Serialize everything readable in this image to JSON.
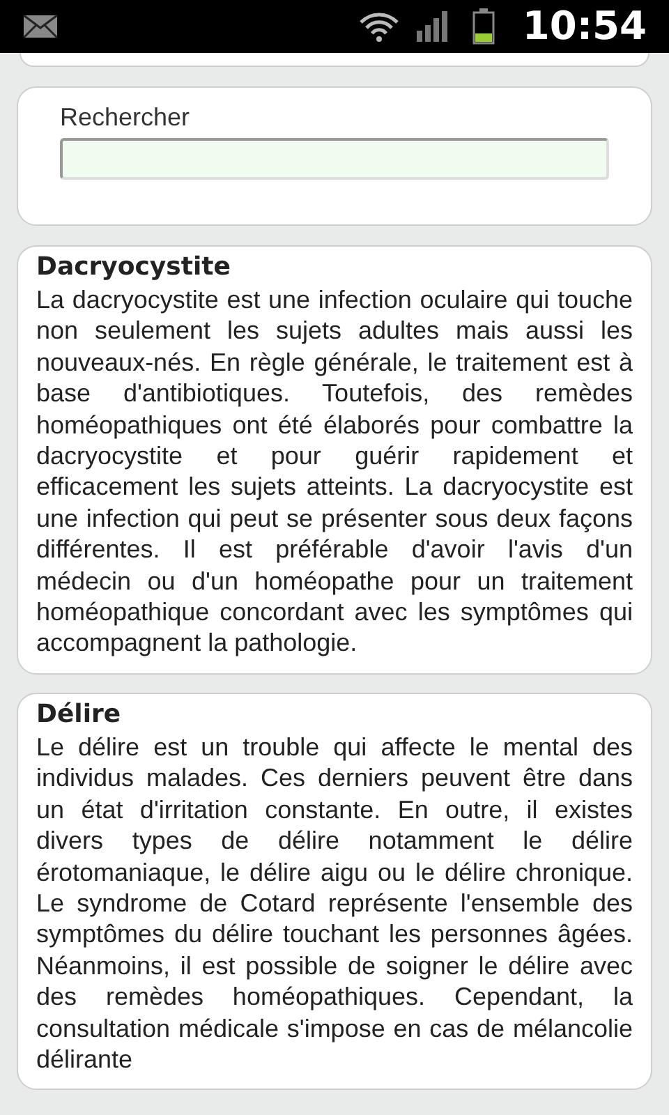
{
  "status_bar": {
    "time": "10:54"
  },
  "search": {
    "label": "Rechercher"
  },
  "articles": [
    {
      "title": "Dacryocystite",
      "body": "La dacryocystite est une infection oculaire qui touche non seulement les sujets adultes mais aussi les nouveaux-nés. En règle générale, le traitement est à base d'antibiotiques. Toutefois, des remèdes homéopathiques ont été élaborés pour combattre la dacryocystite et pour guérir rapidement et efficacement les sujets atteints. La dacryocystite est une infection qui peut se présenter sous deux façons différentes. Il est préférable d'avoir l'avis d'un médecin ou d'un homéopathe pour un traitement homéopathique concordant avec les symptômes qui accompagnent la pathologie."
    },
    {
      "title": "Délire",
      "body": "Le délire est un trouble qui affecte le mental des individus malades. Ces derniers peuvent être dans un état d'irritation constante. En outre, il existes divers types de délire notamment le délire érotomaniaque, le délire aigu ou le délire chronique. Le syndrome de Cotard représente l'ensemble des symptômes du délire touchant les personnes âgées. Néanmoins, il est possible de soigner le délire avec des remèdes homéopathiques. Cependant, la consultation médicale s'impose en cas de mélancolie délirante"
    }
  ]
}
